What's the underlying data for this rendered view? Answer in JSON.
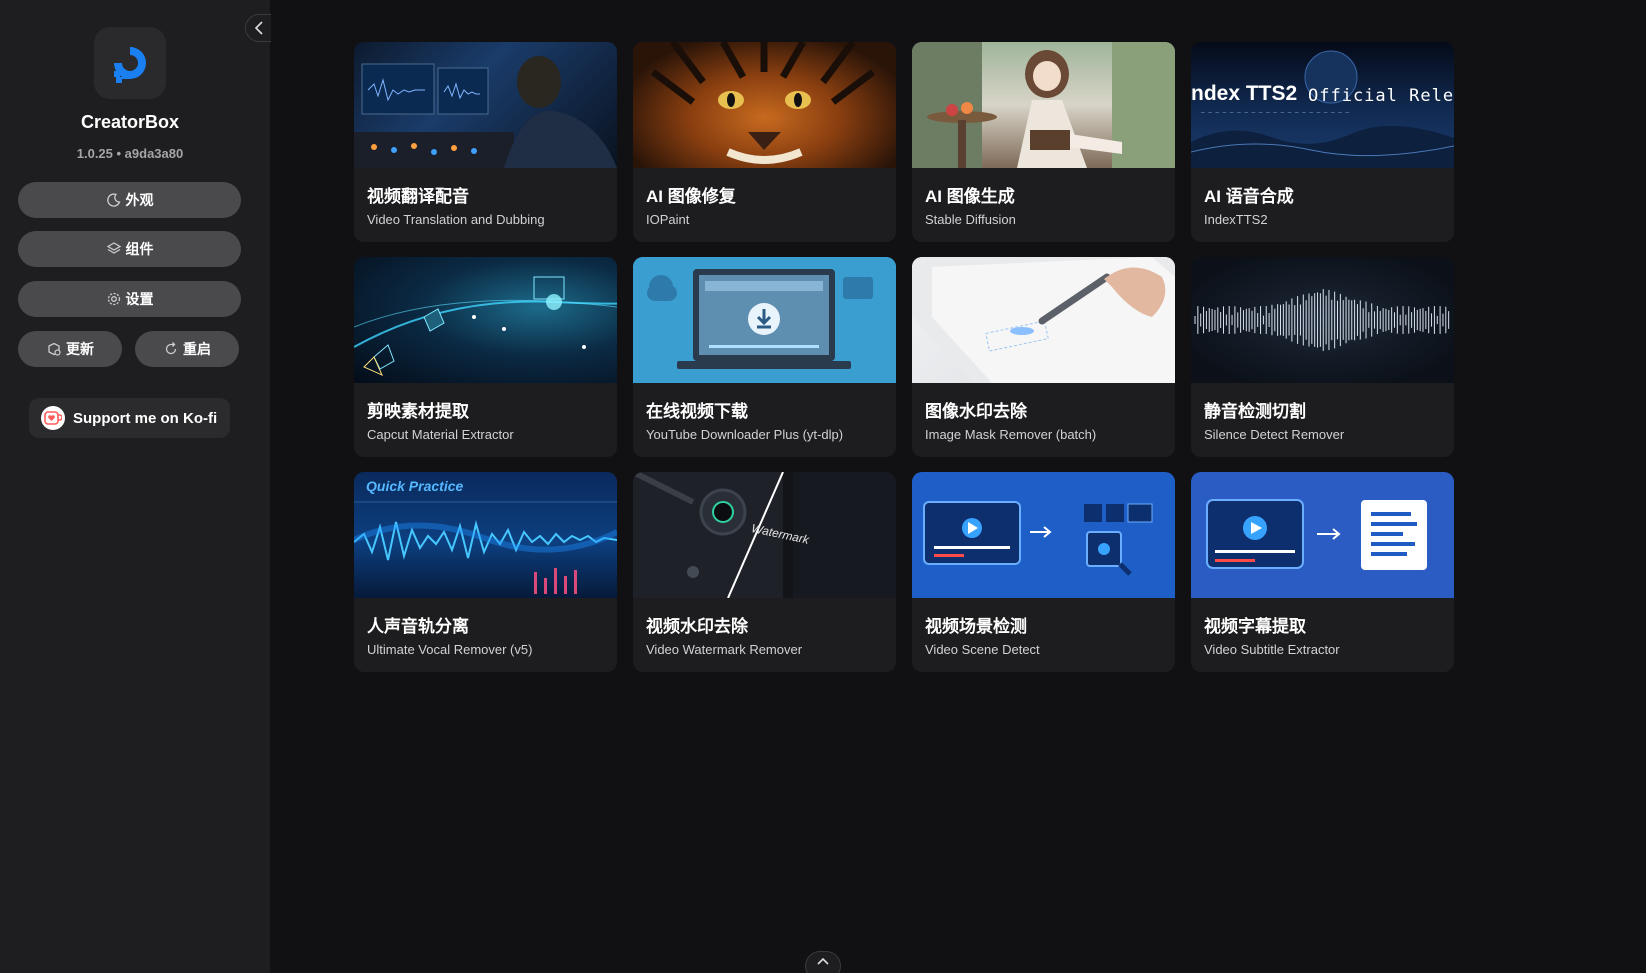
{
  "sidebar": {
    "app_name": "CreatorBox",
    "version": "1.0.25 • a9da3a80",
    "buttons": {
      "appearance": "外观",
      "components": "组件",
      "settings": "设置",
      "update": "更新",
      "restart": "重启"
    },
    "kofi_label": "Support me on Ko-fi"
  },
  "tools": [
    {
      "title": "视频翻译配音",
      "subtitle": "Video Translation and Dubbing"
    },
    {
      "title": "AI 图像修复",
      "subtitle": "IOPaint"
    },
    {
      "title": "AI 图像生成",
      "subtitle": "Stable Diffusion"
    },
    {
      "title": "AI 语音合成",
      "subtitle": "IndexTTS2",
      "thumb_text": "ndex TTS2",
      "thumb_text_2": "Official Releas"
    },
    {
      "title": "剪映素材提取",
      "subtitle": "Capcut Material Extractor"
    },
    {
      "title": "在线视频下载",
      "subtitle": "YouTube Downloader Plus (yt-dlp)"
    },
    {
      "title": "图像水印去除",
      "subtitle": "Image Mask Remover (batch)"
    },
    {
      "title": "静音检测切割",
      "subtitle": "Silence Detect Remover"
    },
    {
      "title": "人声音轨分离",
      "subtitle": "Ultimate Vocal Remover (v5)",
      "thumb_text": "Quick Practice"
    },
    {
      "title": "视频水印去除",
      "subtitle": "Video Watermark Remover",
      "thumb_text": "Watermark"
    },
    {
      "title": "视频场景检测",
      "subtitle": "Video Scene Detect"
    },
    {
      "title": "视频字幕提取",
      "subtitle": "Video Subtitle Extractor"
    }
  ],
  "colors": {
    "background": "#111113",
    "sidebar": "#1e1e20",
    "card": "#1d1d1f",
    "button": "#4a4a4d",
    "accent_blue": "#1a8fff"
  }
}
